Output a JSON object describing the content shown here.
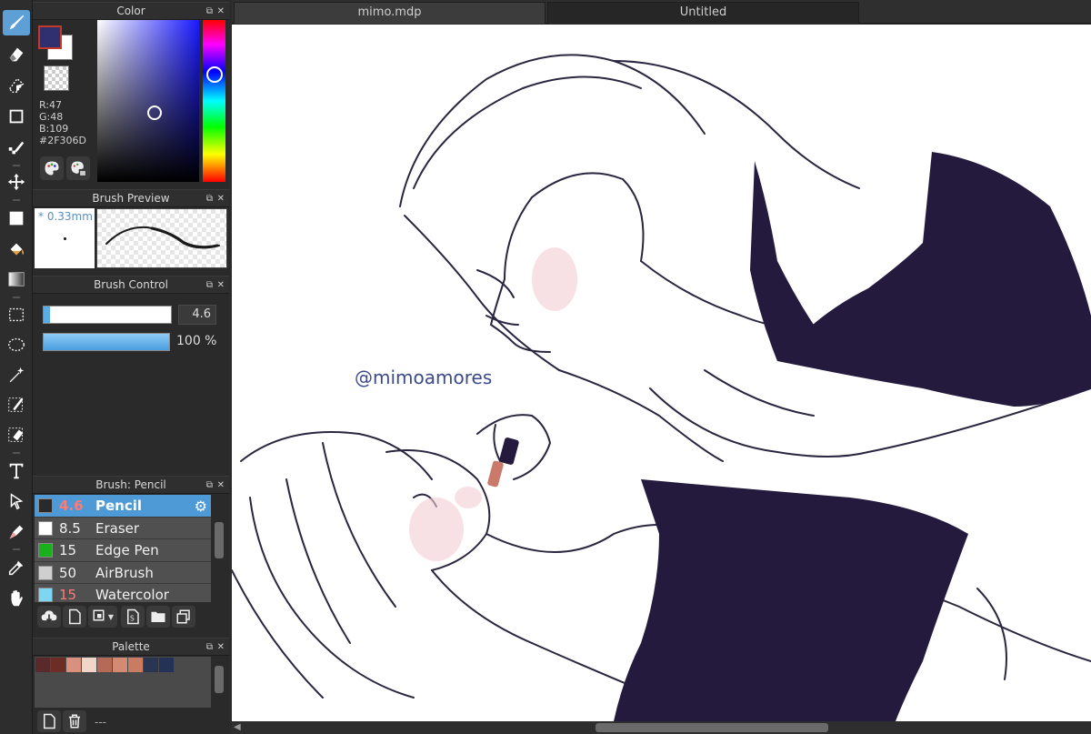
{
  "tools": [
    {
      "name": "brush-tool",
      "icon": "brush-icon",
      "active": true
    },
    {
      "name": "eraser-tool",
      "icon": "eraser-icon"
    },
    {
      "name": "select-eraser-tool",
      "icon": "dotted-eraser-icon"
    },
    {
      "name": "shape-tool",
      "icon": "rectangle-icon"
    },
    {
      "name": "dot-tool",
      "icon": "dot-pen-icon"
    },
    {
      "name": "move-tool",
      "icon": "move-arrows-icon"
    },
    {
      "name": "fill-rect-tool",
      "icon": "filled-square-icon"
    },
    {
      "name": "bucket-tool",
      "icon": "paint-bucket-icon"
    },
    {
      "name": "gradient-tool",
      "icon": "gradient-icon"
    },
    {
      "name": "rect-select-tool",
      "icon": "rect-select-icon"
    },
    {
      "name": "lasso-tool",
      "icon": "lasso-icon"
    },
    {
      "name": "magic-wand-tool",
      "icon": "magic-wand-icon"
    },
    {
      "name": "select-pen-tool",
      "icon": "select-pen-icon"
    },
    {
      "name": "select-eraser2-tool",
      "icon": "select-eraser-icon"
    },
    {
      "name": "text-tool",
      "icon": "text-icon"
    },
    {
      "name": "operation-tool",
      "icon": "pointer-icon"
    },
    {
      "name": "dropper-tool",
      "icon": "eyedropper-icon"
    },
    {
      "name": "hand-tool",
      "icon": "hand-icon"
    }
  ],
  "color_panel": {
    "title": "Color",
    "fg_color": "#2F306D",
    "bg_color": "#FFFFFF",
    "r": "R:47",
    "g": "G:48",
    "b": "B:109",
    "hex": "#2F306D"
  },
  "brush_preview": {
    "title": "Brush Preview",
    "size_label": "* 0.33mm"
  },
  "brush_control": {
    "title": "Brush Control",
    "size_value": "4.6",
    "size_fraction": 0.05,
    "opacity_value": "100 %",
    "opacity_fraction": 1.0
  },
  "brush_list": {
    "title": "Brush: Pencil",
    "items": [
      {
        "size": "4.6",
        "name": "Pencil",
        "color": "#2a2a2a",
        "selected": true,
        "size_red": true
      },
      {
        "size": "8.5",
        "name": "Eraser",
        "color": "#ffffff",
        "selected": false,
        "size_red": false
      },
      {
        "size": "15",
        "name": "Edge Pen",
        "color": "#19b01b",
        "selected": false,
        "size_red": false
      },
      {
        "size": "50",
        "name": "AirBrush",
        "color": "#cfcfcf",
        "selected": false,
        "size_red": false
      },
      {
        "size": "15",
        "name": "Watercolor",
        "color": "#7fd6f2",
        "selected": false,
        "size_red": true
      }
    ]
  },
  "palette": {
    "title": "Palette",
    "colors": [
      "#5a2a2a",
      "#6b2d24",
      "#d9907e",
      "#f0d6c9",
      "#b56a57",
      "#d28a73",
      "#c97c62",
      "#2a3552",
      "#253258"
    ],
    "footer_label": "---"
  },
  "tabs": [
    {
      "label": "mimo.mdp",
      "active": true
    },
    {
      "label": "Untitled",
      "active": false
    }
  ],
  "artwork": {
    "signature": "@mimoamores"
  }
}
